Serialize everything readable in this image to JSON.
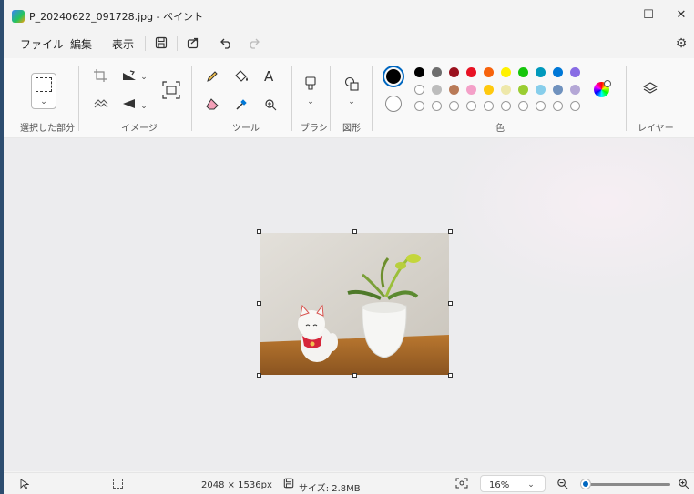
{
  "window": {
    "title": "P_20240622_091728.jpg - ペイント",
    "minimize": "—",
    "maximize": "☐",
    "close": "✕"
  },
  "menu": {
    "file": "ファイル",
    "edit": "編集",
    "view": "表示"
  },
  "ribbon": {
    "groups": {
      "selection": "選択した部分",
      "image": "イメージ",
      "tools": "ツール",
      "brush": "ブラシ",
      "shapes": "図形",
      "colors": "色",
      "layers": "レイヤー"
    },
    "text_tool": "A"
  },
  "palette": {
    "primary": "#000000",
    "secondary": "#ffffff",
    "row1": [
      "#000000",
      "#6e6e6e",
      "#9b111e",
      "#e81224",
      "#f7630c",
      "#fff100",
      "#16c60c",
      "#0099bc",
      "#0078d7",
      "#886ce4"
    ],
    "row2": [
      "#ffffff",
      "#bcbcbc",
      "#b97a57",
      "#f4a0c8",
      "#ffc90e",
      "#eee8aa",
      "#9acd32",
      "#87ceeb",
      "#7092be",
      "#b4a7d6"
    ]
  },
  "status": {
    "dimensions": "2048 × 1536px",
    "size": "サイズ: 2.8MB",
    "zoom": "16%",
    "zoom_level": 0.03
  },
  "icons": [
    "paint-app-icon",
    "save-icon",
    "share-icon",
    "undo-icon",
    "redo-icon",
    "settings-icon",
    "crop-icon",
    "rotate-icon",
    "flip-icon",
    "resize-icon",
    "remove-background-icon",
    "pencil-icon",
    "fill-icon",
    "text-icon",
    "eraser-icon",
    "color-picker-icon",
    "magnifier-icon",
    "brush-icon",
    "shapes-icon",
    "edit-colors-icon",
    "layers-icon",
    "pointer-icon",
    "selection-icon",
    "save-status-icon",
    "fit-icon",
    "zoom-out-icon",
    "zoom-in-icon"
  ]
}
